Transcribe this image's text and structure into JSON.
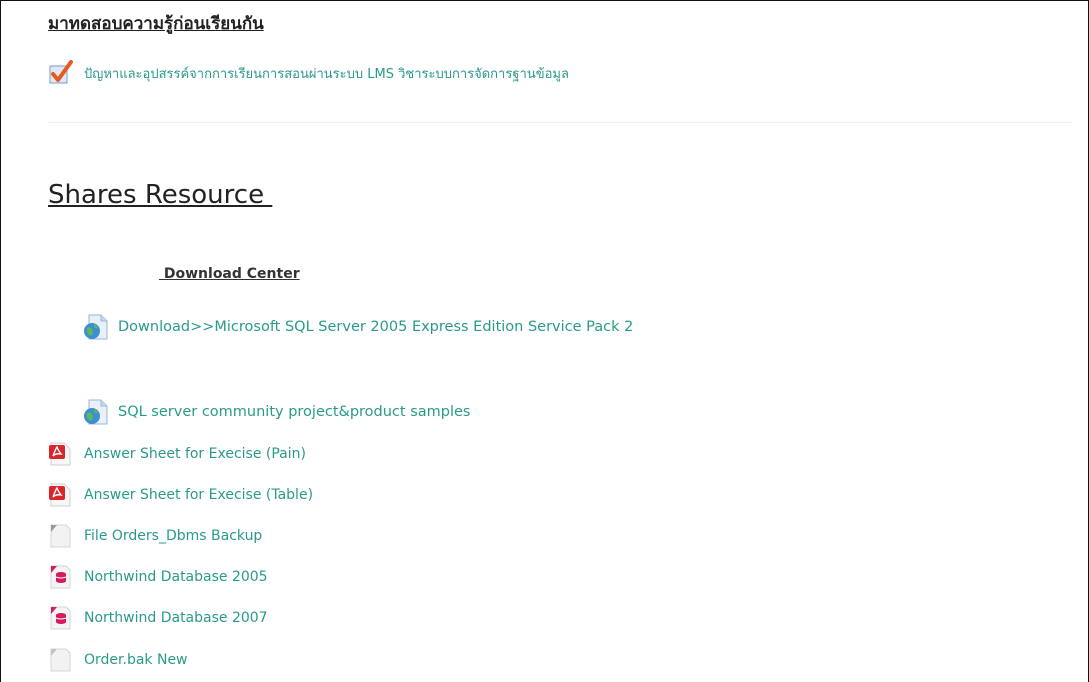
{
  "topic1": {
    "heading": "มาทดสอบความรู้ก่อนเรียนกัน",
    "quiz": {
      "label": "ปัญหาและอุปสรรค์จากการเรียนการสอนผ่านระบบ LMS วิชาระบบการจัดการฐานข้อมูล",
      "icon": "checkmark-quiz-icon"
    }
  },
  "topic2": {
    "heading": "Shares Resource ",
    "subheading": " Download Center",
    "resources": [
      {
        "label": "Download>>Microsoft SQL Server 2005 Express Edition Service Pack 2",
        "icon": "web-link-icon"
      },
      {
        "label": "SQL server community project&product samples",
        "icon": "web-link-icon"
      },
      {
        "label": "Answer Sheet for Execise (Pain)",
        "icon": "pdf-icon"
      },
      {
        "label": "Answer Sheet for Execise (Table)",
        "icon": "pdf-icon"
      },
      {
        "label": "File Orders_Dbms Backup",
        "icon": "file-icon"
      },
      {
        "label": "Northwind Database 2005",
        "icon": "database-file-icon"
      },
      {
        "label": "Northwind Database 2007",
        "icon": "database-file-icon"
      },
      {
        "label": "Order.bak New",
        "icon": "file-icon"
      }
    ]
  },
  "colors": {
    "link": "#2a9a8a",
    "heading": "#222222",
    "pdf": "#d8262b",
    "database": "#d81b60"
  }
}
